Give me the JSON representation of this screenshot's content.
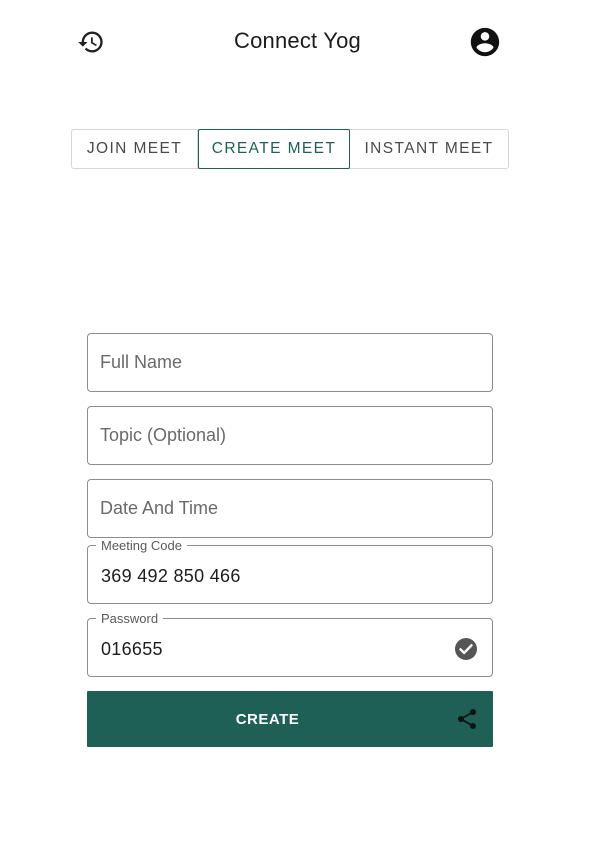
{
  "header": {
    "title": "Connect Yog",
    "left_icon": "history-icon",
    "right_icon": "account-circle-icon"
  },
  "tabs": [
    {
      "label": "JOIN MEET",
      "selected": false
    },
    {
      "label": "CREATE MEET",
      "selected": true
    },
    {
      "label": "INSTANT MEET",
      "selected": false
    }
  ],
  "form": {
    "full_name": {
      "placeholder": "Full Name",
      "value": ""
    },
    "topic": {
      "placeholder": "Topic (Optional)",
      "value": ""
    },
    "date_time": {
      "placeholder": "Date And Time",
      "value": ""
    },
    "meeting_code": {
      "label": "Meeting Code",
      "value": "369 492 850 466"
    },
    "password": {
      "label": "Password",
      "value": "016655",
      "status_icon": "check-circle-icon"
    }
  },
  "create_button": {
    "label": "CREATE",
    "icon": "share-icon"
  },
  "colors": {
    "accent": "#1e5f56",
    "border": "#8c8c8c",
    "background": "#ffffff"
  }
}
